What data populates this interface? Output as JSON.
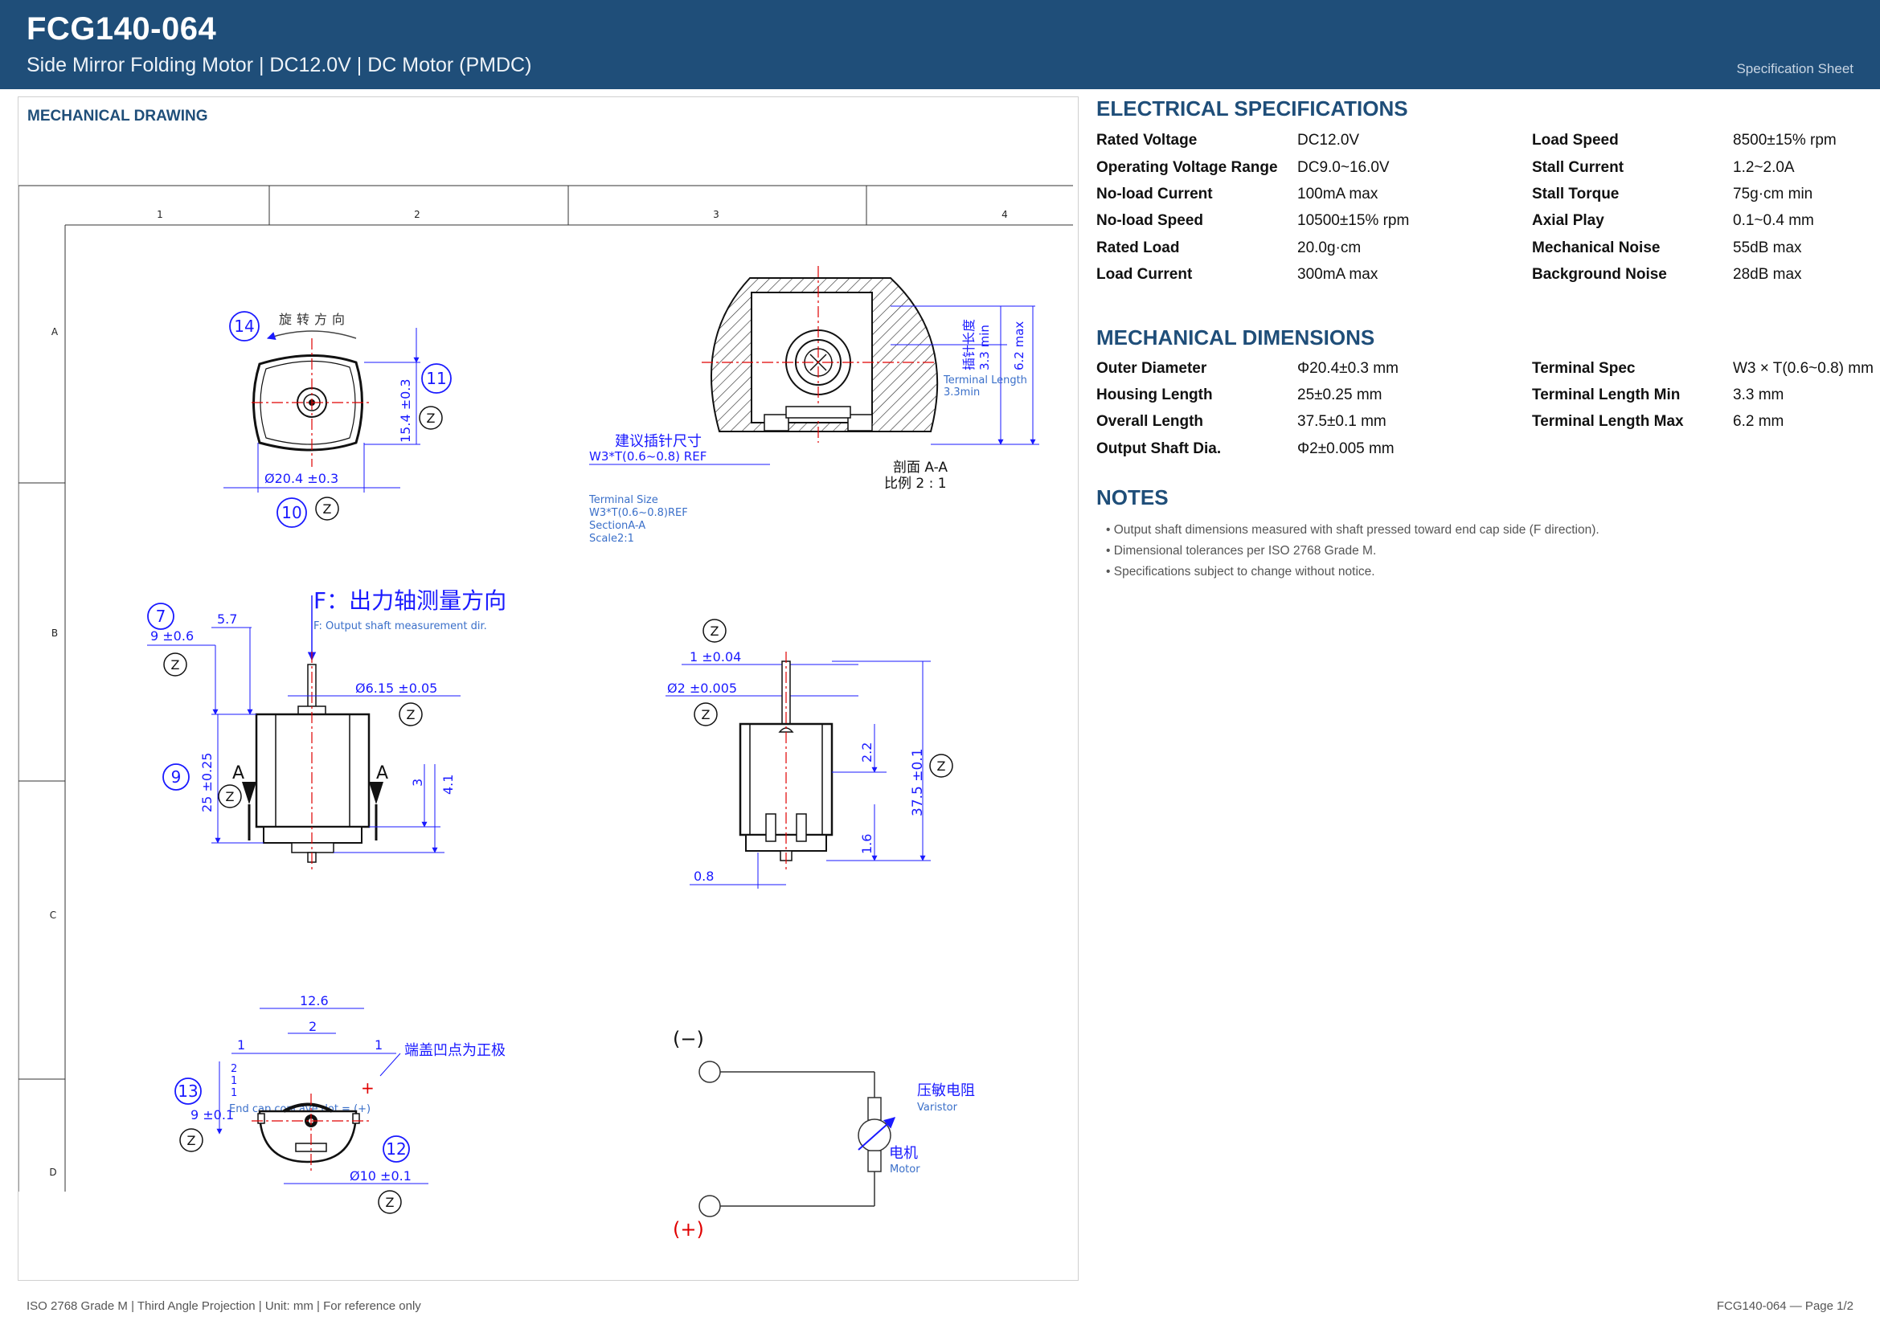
{
  "header": {
    "title": "FCG140-064",
    "subtitle": "Side Mirror Folding Motor  |  DC12.0V  |  DC Motor (PMDC)",
    "sheet_label": "Specification Sheet"
  },
  "drawing": {
    "panel_title": "MECHANICAL DRAWING",
    "columns": [
      "1",
      "2",
      "3",
      "4"
    ],
    "rows": [
      "A",
      "B",
      "C",
      "D"
    ],
    "rotation_label": "旋转方向",
    "balloons": {
      "b14": "14",
      "b11": "11",
      "b10": "10",
      "b7": "7",
      "b9": "9",
      "b13": "13",
      "b12": "12"
    },
    "z_symbol": "Z",
    "dims": {
      "height_15_4": "15.4 ±0.3",
      "dia_20_4": "Ø20.4 ±0.3",
      "len_5_7": "5.7",
      "shaft_9": "9 ±0.6",
      "dia_6_15": "Ø6.15 ±0.05",
      "len_25": "25 ±0.25",
      "len_3": "3",
      "len_4_1": "4.1",
      "section_A_left": "A",
      "section_A_right": "A",
      "len_1": "1 ±0.04",
      "dia_2": "Ø2 ±0.005",
      "len_1_6": "1.6",
      "len_2_2": "2.2",
      "len_37_5": "37.5 ±0.1",
      "len_0_8": "0.8",
      "len_12_6": "12.6",
      "len_2": "2",
      "len_1a": "1",
      "len_1b": "1",
      "vert_2": "2",
      "vert_1a": "1",
      "vert_1b": "1",
      "dia_9": "9 ±0.1",
      "dia_10": "Ø10 ±0.1",
      "term_len": "插针长度",
      "term_min": "3.3 min",
      "term_max": "6.2 max"
    },
    "section_view": {
      "terminal_length_en": "Terminal Length",
      "terminal_length_min": "3.3min",
      "suggest_cn": "建议插针尺寸",
      "suggest_size": "W3*T(0.6~0.8) REF",
      "section_cn": "剖面 A-A",
      "scale_cn": "比例 2 : 1",
      "notes_en": [
        "Terminal Size",
        "W3*T(0.6~0.8)REF",
        "SectionA-A",
        "Scale2:1"
      ]
    },
    "force": {
      "label_cn": "F：出力轴测量方向",
      "label_en": "F: Output shaft measurement dir."
    },
    "end_cap": {
      "label_cn": "端盖凹点为正极",
      "label_en": "End cap concave dot = (+)",
      "plus": "+"
    },
    "circuit": {
      "minus": "(−)",
      "plus": "(+)",
      "varistor_cn": "压敏电阻",
      "varistor_en": "Varistor",
      "motor_cn": "电机",
      "motor_en": "Motor"
    }
  },
  "electrical": {
    "title": "ELECTRICAL SPECIFICATIONS",
    "left": [
      {
        "k": "Rated Voltage",
        "v": "DC12.0V"
      },
      {
        "k": "Operating Voltage Range",
        "v": "DC9.0~16.0V"
      },
      {
        "k": "No-load Current",
        "v": "100mA max"
      },
      {
        "k": "No-load Speed",
        "v": "10500±15% rpm"
      },
      {
        "k": "Rated Load",
        "v": "20.0g·cm"
      },
      {
        "k": "Load Current",
        "v": "300mA max"
      }
    ],
    "right": [
      {
        "k": "Load Speed",
        "v": "8500±15% rpm"
      },
      {
        "k": "Stall Current",
        "v": "1.2~2.0A"
      },
      {
        "k": "Stall Torque",
        "v": "75g·cm min"
      },
      {
        "k": "Axial Play",
        "v": "0.1~0.4 mm"
      },
      {
        "k": "Mechanical Noise",
        "v": "55dB max"
      },
      {
        "k": "Background Noise",
        "v": "28dB max"
      }
    ]
  },
  "mechanical": {
    "title": "MECHANICAL DIMENSIONS",
    "left": [
      {
        "k": "Outer Diameter",
        "v": "Φ20.4±0.3 mm"
      },
      {
        "k": "Housing Length",
        "v": "25±0.25 mm"
      },
      {
        "k": "Overall Length",
        "v": "37.5±0.1 mm"
      },
      {
        "k": "Output Shaft Dia.",
        "v": "Φ2±0.005 mm"
      }
    ],
    "right": [
      {
        "k": "Terminal Spec",
        "v": "W3 × T(0.6~0.8) mm"
      },
      {
        "k": "Terminal Length Min",
        "v": "3.3 mm"
      },
      {
        "k": "Terminal Length Max",
        "v": "6.2 mm"
      }
    ]
  },
  "notes": {
    "title": "NOTES",
    "items": [
      "• Output shaft dimensions measured with shaft pressed toward end cap side (F direction).",
      "• Dimensional tolerances per ISO 2768 Grade M.",
      "• Specifications subject to change without notice."
    ]
  },
  "footer": {
    "left": "ISO 2768 Grade M  |  Third Angle Projection  |  Unit: mm  |  For reference only",
    "right": "FCG140-064  —  Page 1/2"
  },
  "colors": {
    "header_bg": "#1f4e79",
    "dimension_blue": "#1a1aff",
    "centerline_red": "#e00000"
  }
}
